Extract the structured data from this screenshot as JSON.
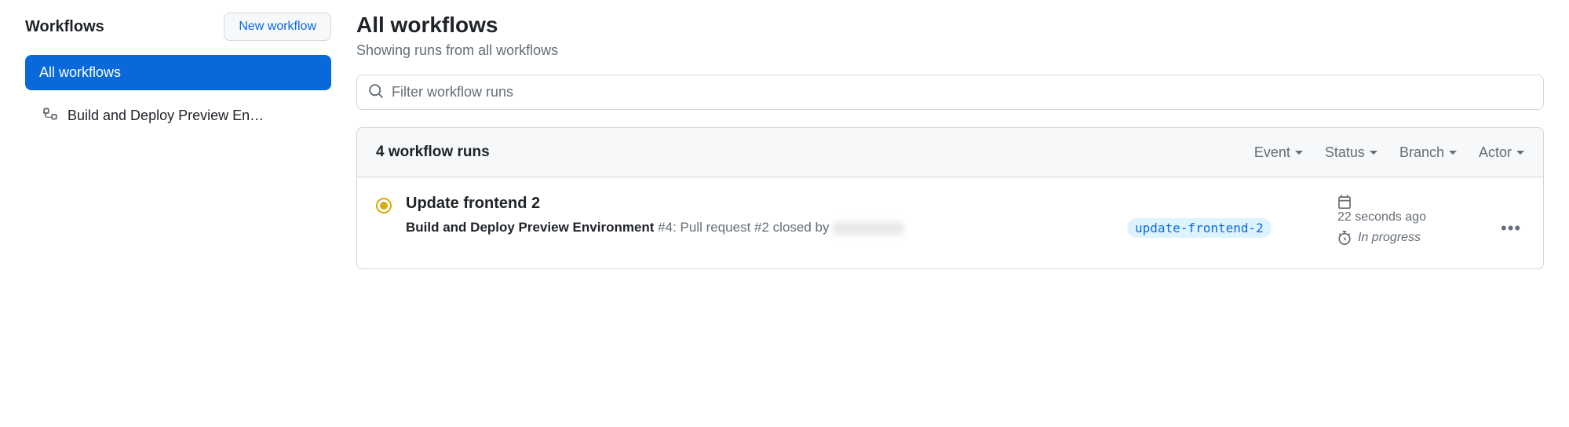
{
  "sidebar": {
    "title": "Workflows",
    "new_button": "New workflow",
    "items": [
      {
        "label": "All workflows",
        "active": true
      },
      {
        "label": "Build and Deploy Preview En…",
        "active": false
      }
    ]
  },
  "page": {
    "title": "All workflows",
    "subtitle": "Showing runs from all workflows"
  },
  "search": {
    "placeholder": "Filter workflow runs"
  },
  "runs": {
    "count_label": "4 workflow runs",
    "filters": {
      "event": "Event",
      "status": "Status",
      "branch": "Branch",
      "actor": "Actor"
    },
    "items": [
      {
        "title": "Update frontend 2",
        "workflow_name": "Build and Deploy Preview Environment",
        "run_number_prefix": " #4",
        "event_text": ": Pull request #2 closed by ",
        "branch": "update-frontend-2",
        "time_ago": "22 seconds ago",
        "duration_status": "In progress"
      }
    ]
  }
}
